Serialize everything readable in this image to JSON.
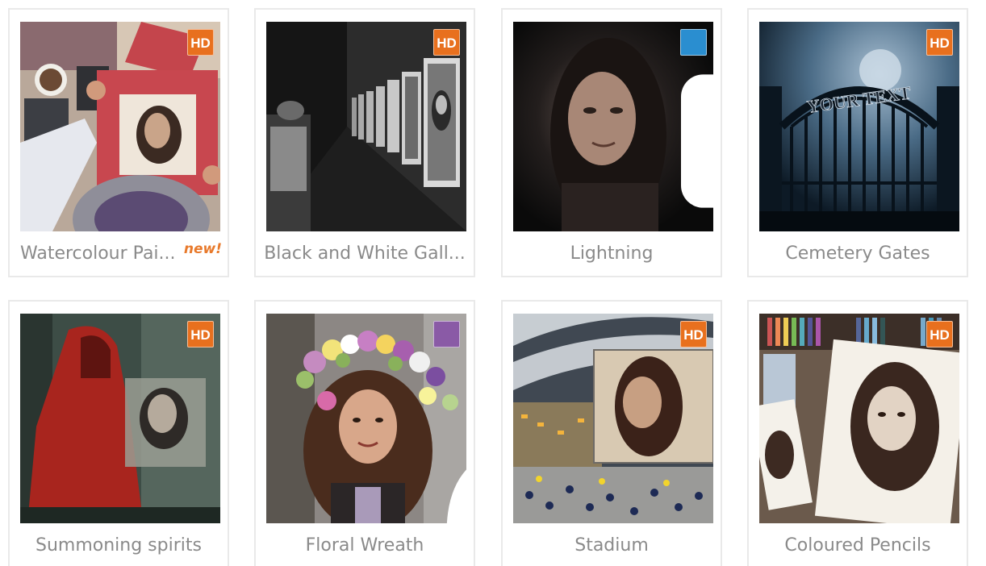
{
  "colors": {
    "hd_badge": "#e8701e",
    "video_badge": "#2a8ed0",
    "portrait_badge": "#8a5aa6",
    "title_text": "#8a8a8a",
    "new_tag": "#e87a2c",
    "card_border": "#e9e9e9"
  },
  "cards": [
    {
      "title": "Watercolour Pai...",
      "badge": "HD",
      "badge_type": "hd",
      "tag": "new!"
    },
    {
      "title": "Black and White Gall...",
      "badge": "HD",
      "badge_type": "hd"
    },
    {
      "title": "Lightning",
      "badge": "",
      "badge_type": "video",
      "badge_icon": "video-camera-icon"
    },
    {
      "title": "Cemetery Gates",
      "badge": "HD",
      "badge_type": "hd",
      "image_text": "YOUR TEXT"
    },
    {
      "title": "Summoning spirits",
      "badge": "HD",
      "badge_type": "hd"
    },
    {
      "title": "Floral Wreath",
      "badge": "",
      "badge_type": "portrait",
      "badge_icon": "person-icon"
    },
    {
      "title": "Stadium",
      "badge": "HD",
      "badge_type": "hd"
    },
    {
      "title": "Coloured Pencils",
      "badge": "HD",
      "badge_type": "hd"
    }
  ]
}
